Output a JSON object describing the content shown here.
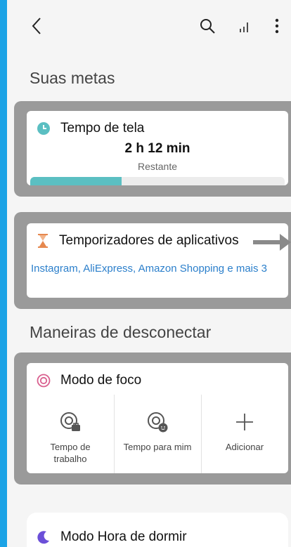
{
  "colors": {
    "accent_border": "#1ba3e6",
    "progress": "#5bbfc2",
    "link": "#2b7fcb",
    "hourglass": "#e6884e",
    "focus": "#d9608f",
    "moon": "#6b4fd8"
  },
  "toolbar": {
    "back_icon": "chevron-left-icon",
    "search_icon": "search-icon",
    "stats_icon": "bar-chart-icon",
    "more_icon": "more-vertical-icon"
  },
  "goals": {
    "title": "Suas metas",
    "screen_time": {
      "icon": "clock-icon",
      "label": "Tempo de tela",
      "value": "2 h 12 min",
      "subtitle": "Restante",
      "progress": 0.36
    },
    "app_timers": {
      "icon": "hourglass-icon",
      "label": "Temporizadores de aplicativos",
      "apps": "Instagram, AliExpress, Amazon Shopping e mais 3"
    }
  },
  "disconnect": {
    "title": "Maneiras de desconectar",
    "focus_mode": {
      "icon": "focus-target-icon",
      "label": "Modo de foco",
      "actions": [
        {
          "icon": "work-focus-icon",
          "label": "Tempo de trabalho"
        },
        {
          "icon": "me-time-focus-icon",
          "label": "Tempo para mim"
        },
        {
          "icon": "plus-icon",
          "label": "Adicionar"
        }
      ]
    },
    "bedtime_mode": {
      "icon": "moon-icon",
      "label": "Modo Hora de dormir"
    }
  }
}
